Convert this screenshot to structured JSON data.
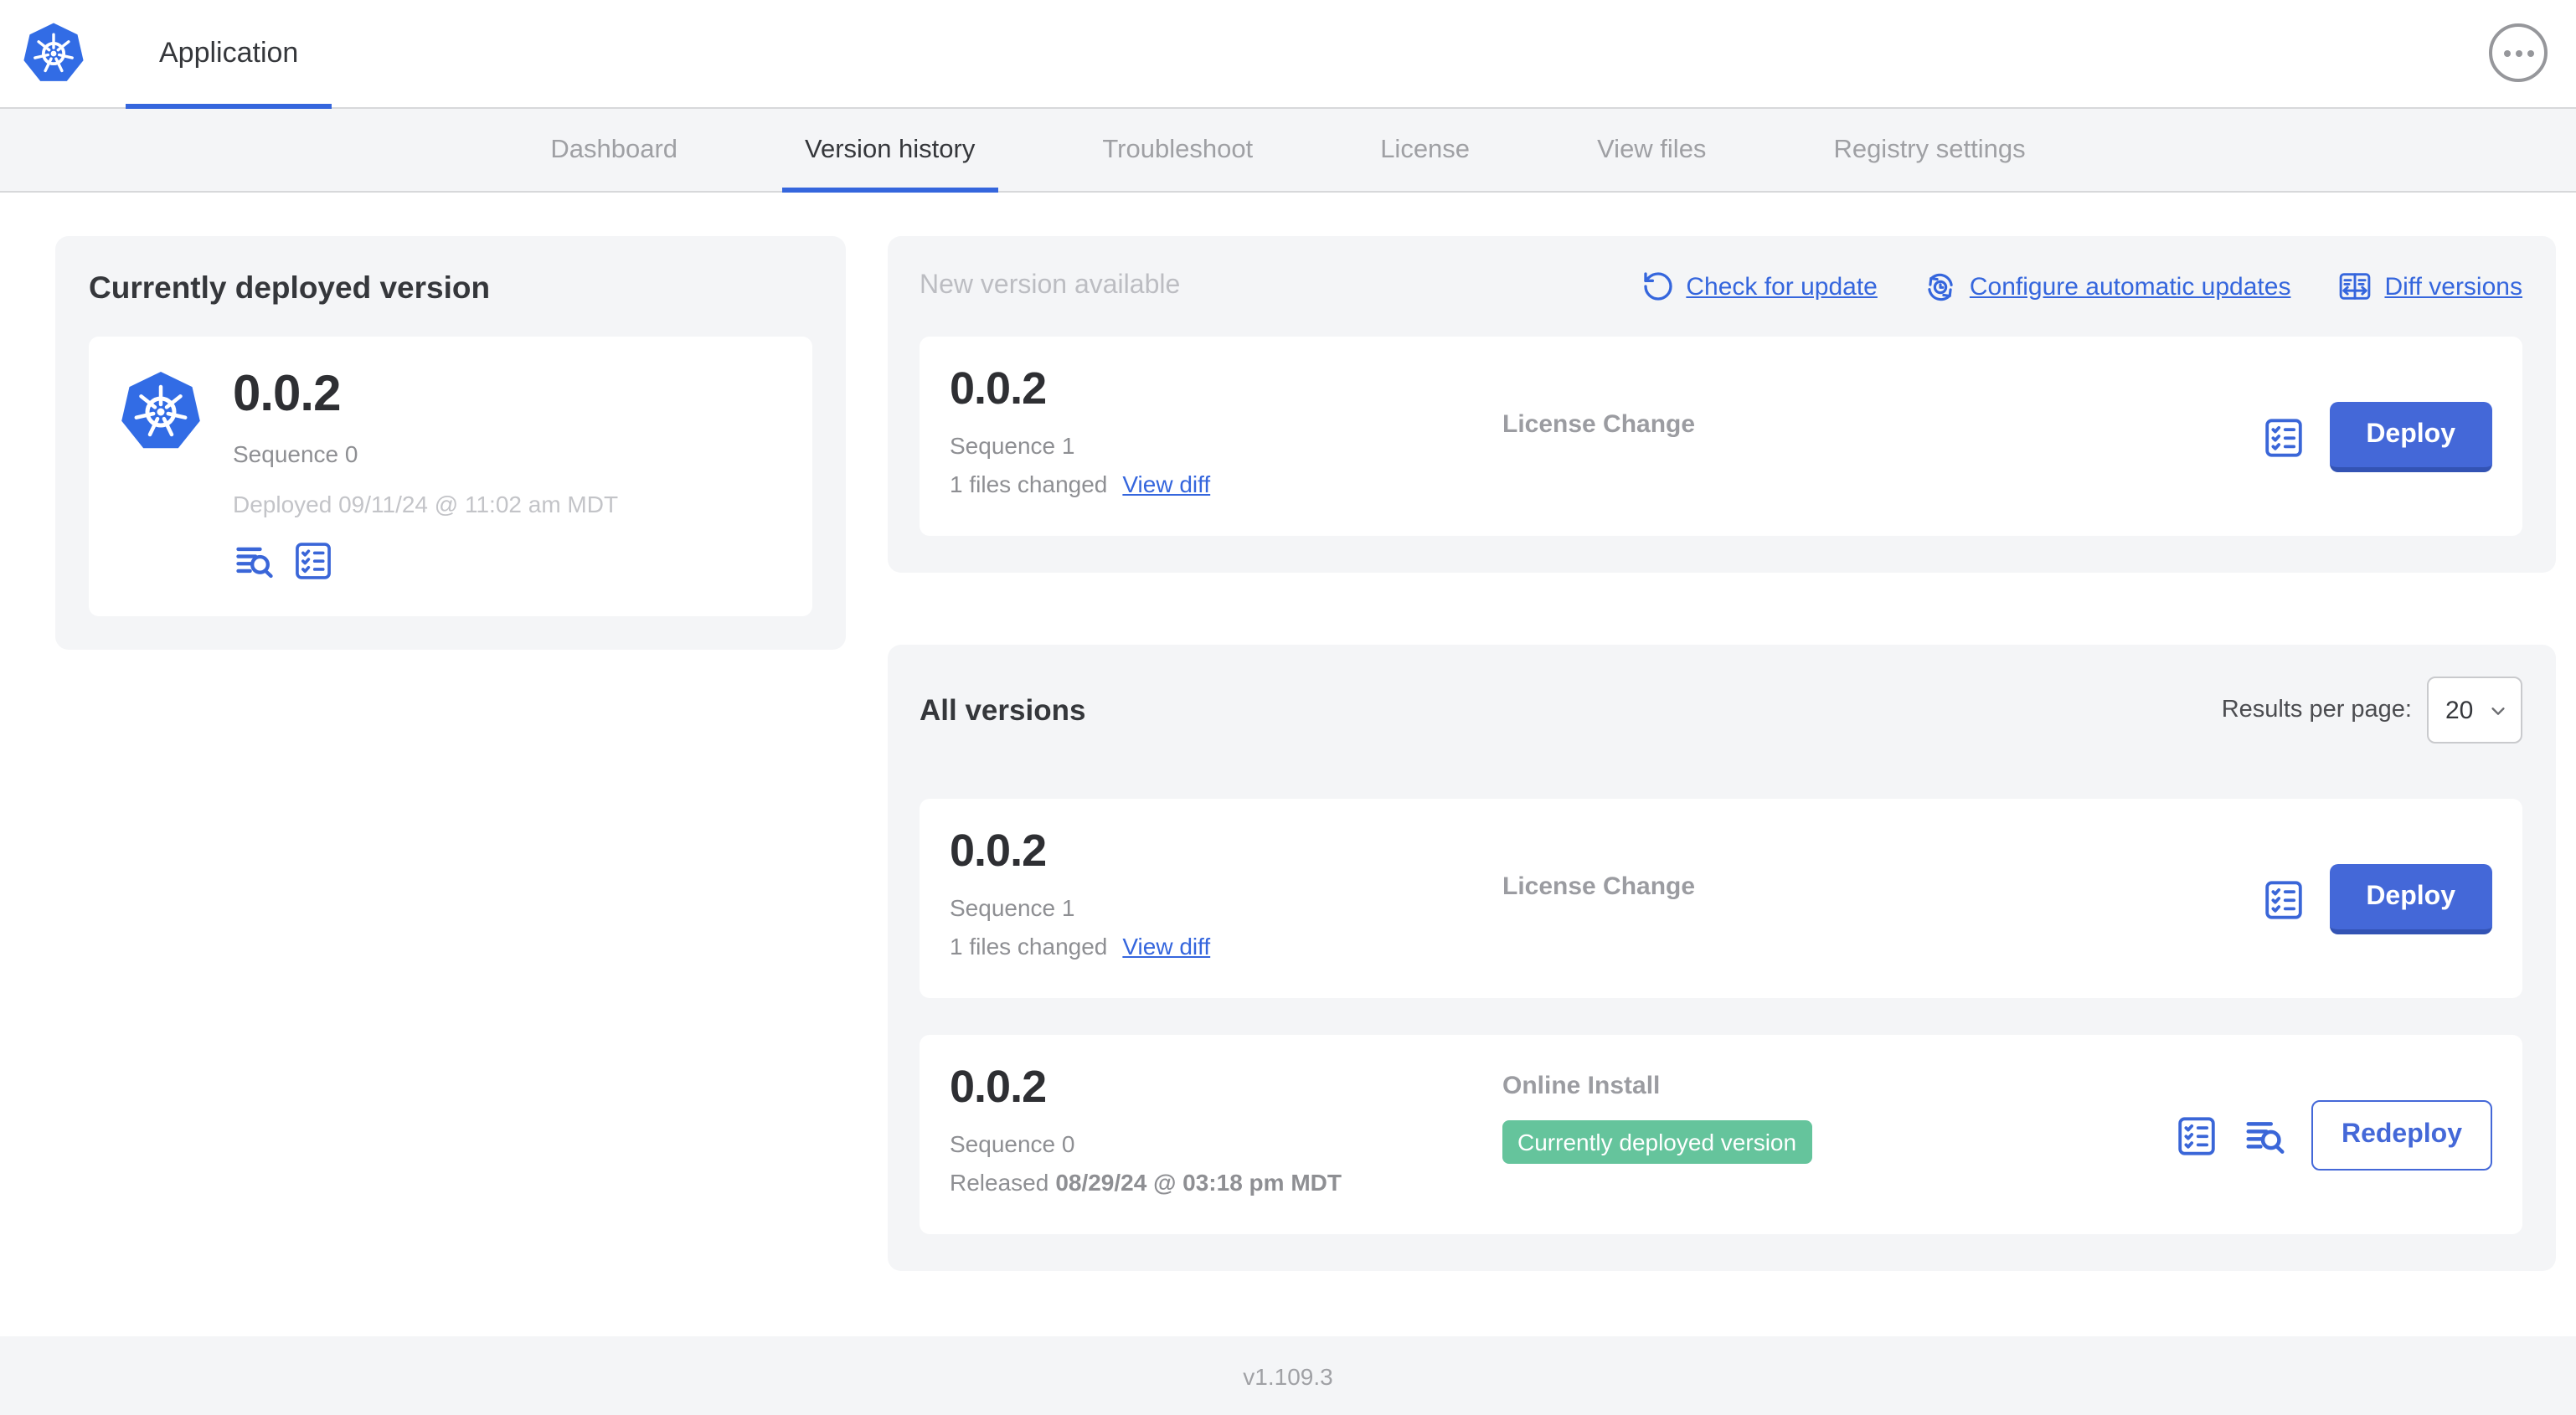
{
  "header": {
    "app_tab_label": "Application"
  },
  "nav": {
    "tabs": [
      {
        "label": "Dashboard",
        "active": false
      },
      {
        "label": "Version history",
        "active": true
      },
      {
        "label": "Troubleshoot",
        "active": false
      },
      {
        "label": "License",
        "active": false
      },
      {
        "label": "View files",
        "active": false
      },
      {
        "label": "Registry settings",
        "active": false
      }
    ]
  },
  "current_version": {
    "title": "Currently deployed version",
    "version": "0.0.2",
    "sequence": "Sequence 0",
    "deployed": "Deployed 09/11/24 @ 11:02 am MDT"
  },
  "new_version": {
    "title": "New version available",
    "links": {
      "check_for_update": "Check for update",
      "configure_automatic_updates": "Configure automatic updates",
      "diff_versions": "Diff versions"
    },
    "row": {
      "version": "0.0.2",
      "sequence": "Sequence 1",
      "files_changed": "1 files changed",
      "view_diff": "View diff",
      "source": "License Change",
      "action": "Deploy"
    }
  },
  "all_versions": {
    "title": "All versions",
    "results_per_page_label": "Results per page:",
    "results_per_page_value": "20",
    "rows": [
      {
        "version": "0.0.2",
        "sequence": "Sequence 1",
        "files_changed": "1 files changed",
        "view_diff": "View diff",
        "source": "License Change",
        "action": "Deploy"
      },
      {
        "version": "0.0.2",
        "sequence": "Sequence 0",
        "released_prefix": "Released",
        "released_date": "08/29/24 @ 03:18 pm MDT",
        "source": "Online Install",
        "badge": "Currently deployed version",
        "action": "Redeploy"
      }
    ]
  },
  "footer": {
    "version": "v1.109.3"
  },
  "icons": {
    "app_logo": "kubernetes-wheel-icon",
    "overflow_menu": "ellipsis-circle-icon",
    "check_for_update": "rotate-ccw-icon",
    "configure_automatic_updates": "sync-clock-icon",
    "diff_versions": "split-diff-icon",
    "logs": "log-search-icon",
    "preflight_checks": "checklist-icon",
    "select_chevron": "chevron-down-icon"
  },
  "colors": {
    "link_blue": "#3566dd",
    "button_blue": "#4468d8",
    "button_blue_shadow": "#3353b4",
    "kubernetes_blue": "#326ce5",
    "badge_green": "#65c49c",
    "section_bg": "#f4f5f7",
    "border_gray": "#d7d8da",
    "text_dark": "#35373b",
    "text_muted": "#8e8f93"
  }
}
